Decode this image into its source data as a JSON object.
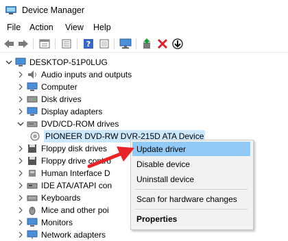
{
  "window": {
    "title": "Device Manager"
  },
  "menubar": {
    "items": [
      "File",
      "Action",
      "View",
      "Help"
    ]
  },
  "toolbar": {
    "icons": [
      "back-icon",
      "forward-icon",
      "properties-icon",
      "show-hide-console-icon",
      "help-icon",
      "update-driver-icon",
      "scan-hardware-icon",
      "add-legacy-icon",
      "uninstall-icon",
      "download-icon"
    ]
  },
  "tree": {
    "root": "DESKTOP-51P0LUG",
    "items": [
      {
        "label": "Audio inputs and outputs",
        "icon": "speaker-icon"
      },
      {
        "label": "Computer",
        "icon": "monitor-icon"
      },
      {
        "label": "Disk drives",
        "icon": "disk-icon"
      },
      {
        "label": "Display adapters",
        "icon": "monitor-icon"
      },
      {
        "label": "DVD/CD-ROM drives",
        "icon": "dvd-drive-icon"
      },
      {
        "label": "PIONEER DVD-RW  DVR-215D ATA Device",
        "icon": "cd-icon"
      },
      {
        "label": "Floppy disk drives",
        "icon": "floppy-icon"
      },
      {
        "label": "Floppy drive contro",
        "icon": "controller-icon"
      },
      {
        "label": "Human Interface D",
        "icon": "hid-icon"
      },
      {
        "label": "IDE ATA/ATAPI con",
        "icon": "ide-icon"
      },
      {
        "label": "Keyboards",
        "icon": "keyboard-icon"
      },
      {
        "label": "Mice and other poi",
        "icon": "mouse-icon"
      },
      {
        "label": "Monitors",
        "icon": "monitor-icon"
      },
      {
        "label": "Network adapters",
        "icon": "network-icon"
      }
    ]
  },
  "context_menu": {
    "update": "Update driver",
    "disable": "Disable device",
    "uninstall": "Uninstall device",
    "scan": "Scan for hardware changes",
    "properties": "Properties"
  },
  "colors": {
    "highlight": "#91c9f7",
    "selection": "#cce8ff",
    "arrow": "#e8232a"
  }
}
